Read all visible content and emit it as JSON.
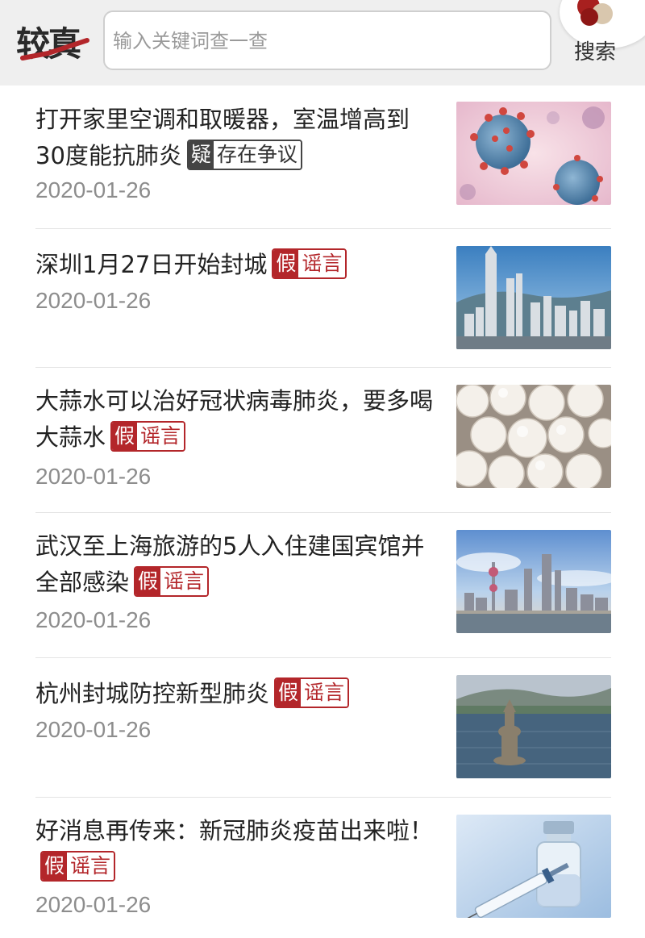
{
  "header": {
    "logo_text": "较真",
    "search_placeholder": "输入关键词查一查",
    "search_button": "搜索"
  },
  "colors": {
    "accent": "#b3262a",
    "doubt": "#444444",
    "header_bg": "#efefef"
  },
  "items": [
    {
      "title": "打开家里空调和取暖器，室温增高到30度能抗肺炎",
      "tag_key": "疑",
      "tag_label": "存在争议",
      "tag_kind": "doubt",
      "date": "2020-01-26",
      "image": "virus-image"
    },
    {
      "title": "深圳1月27日开始封城",
      "tag_key": "假",
      "tag_label": "谣言",
      "tag_kind": "false",
      "date": "2020-01-26",
      "image": "shenzhen-skyline-image"
    },
    {
      "title": "大蒜水可以治好冠状病毒肺炎，要多喝大蒜水",
      "tag_key": "假",
      "tag_label": "谣言",
      "tag_kind": "false",
      "date": "2020-01-26",
      "image": "garlic-image"
    },
    {
      "title": "武汉至上海旅游的5人入住建国宾馆并全部感染",
      "tag_key": "假",
      "tag_label": "谣言",
      "tag_kind": "false",
      "date": "2020-01-26",
      "image": "shanghai-skyline-image"
    },
    {
      "title": "杭州封城防控新型肺炎",
      "tag_key": "假",
      "tag_label": "谣言",
      "tag_kind": "false",
      "date": "2020-01-26",
      "image": "west-lake-image"
    },
    {
      "title": "好消息再传来：新冠肺炎疫苗出来啦！",
      "tag_key": "假",
      "tag_label": "谣言",
      "tag_kind": "false",
      "date": "2020-01-26",
      "image": "vaccine-image"
    }
  ]
}
